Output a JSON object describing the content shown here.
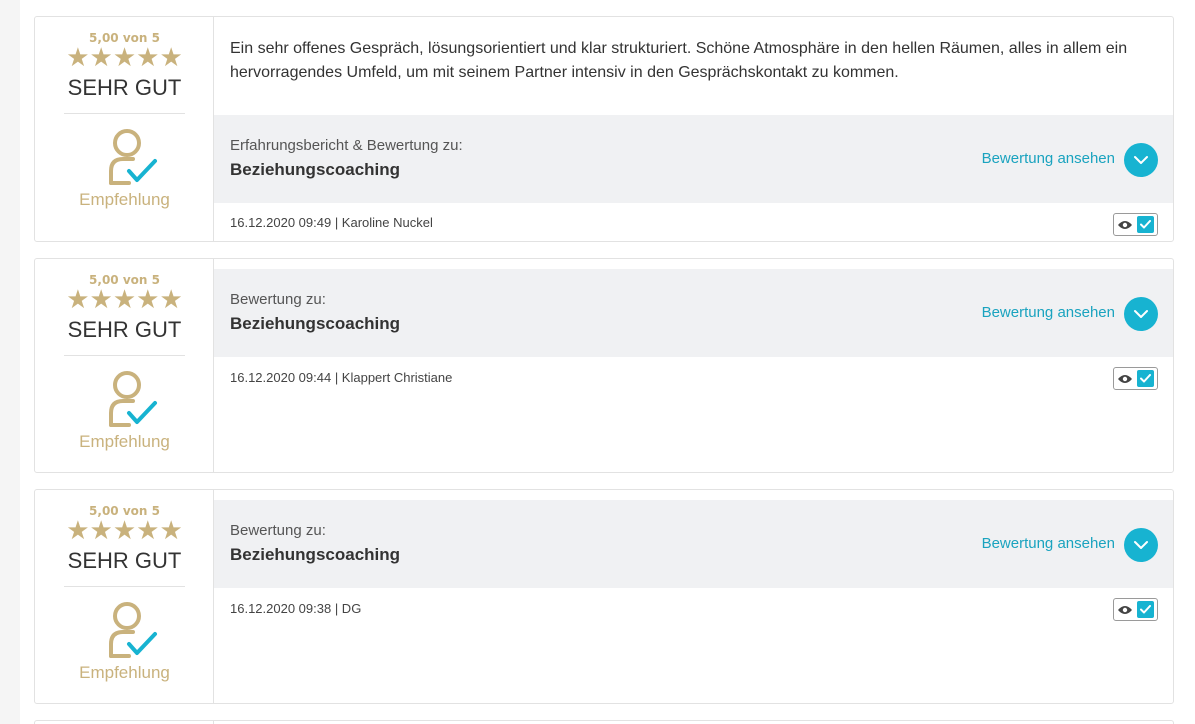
{
  "reviews": [
    {
      "score": "5,00 von 5",
      "stars": "★★★★★",
      "rating_word": "SEHR GUT",
      "recommend": "Empfehlung",
      "text": "Ein sehr offenes Gespräch, lösungsorientiert und klar strukturiert. Schöne Atmosphäre in den hellen Räumen, alles in allem ein hervorragendes Umfeld, um mit seinem Partner intensiv in den Gesprächskontakt zu kommen.",
      "label": "Erfahrungsbericht & Bewertung zu:",
      "product": "Beziehungscoaching",
      "view_link": "Bewertung ansehen",
      "meta": "16.12.2020 09:49 | Karoline Nuckel"
    },
    {
      "score": "5,00 von 5",
      "stars": "★★★★★",
      "rating_word": "SEHR GUT",
      "recommend": "Empfehlung",
      "label": "Bewertung zu:",
      "product": "Beziehungscoaching",
      "view_link": "Bewertung ansehen",
      "meta": "16.12.2020 09:44 | Klappert Christiane"
    },
    {
      "score": "5,00 von 5",
      "stars": "★★★★★",
      "rating_word": "SEHR GUT",
      "recommend": "Empfehlung",
      "label": "Bewertung zu:",
      "product": "Beziehungscoaching",
      "view_link": "Bewertung ansehen",
      "meta": "16.12.2020 09:38 | DG"
    }
  ],
  "colors": {
    "gold": "#c9b27d",
    "accent": "#17b3d1",
    "band": "#f0f1f3"
  },
  "icons": {
    "recommend": "person-check-icon",
    "expand": "chevron-down-icon",
    "visible": "eye-icon",
    "verified": "checkbox-checked-icon"
  }
}
